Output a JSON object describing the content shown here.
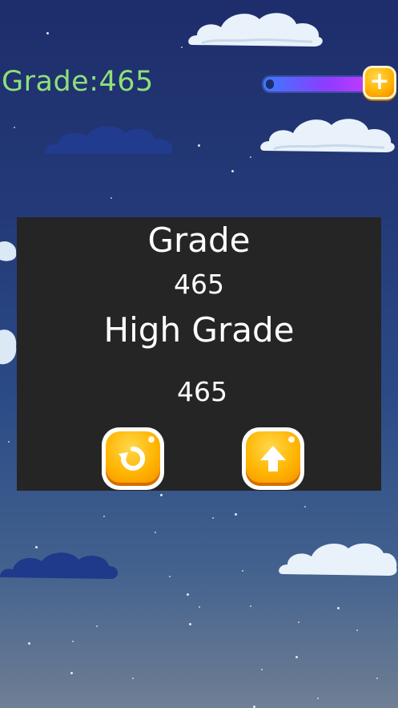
{
  "hud": {
    "grade_text": "Grade:465",
    "progress_fraction": 0.95,
    "plus_symbol": "+"
  },
  "result_panel": {
    "grade_label": "Grade",
    "grade_value": "465",
    "high_grade_label": "High Grade",
    "high_grade_value": "465"
  },
  "buttons": {
    "restart_icon": "restart-icon",
    "up_icon": "arrow-up-icon"
  },
  "colors": {
    "hud_grade": "#8ee07a",
    "panel_bg": "#252525",
    "button_orange": "#ffb400"
  }
}
